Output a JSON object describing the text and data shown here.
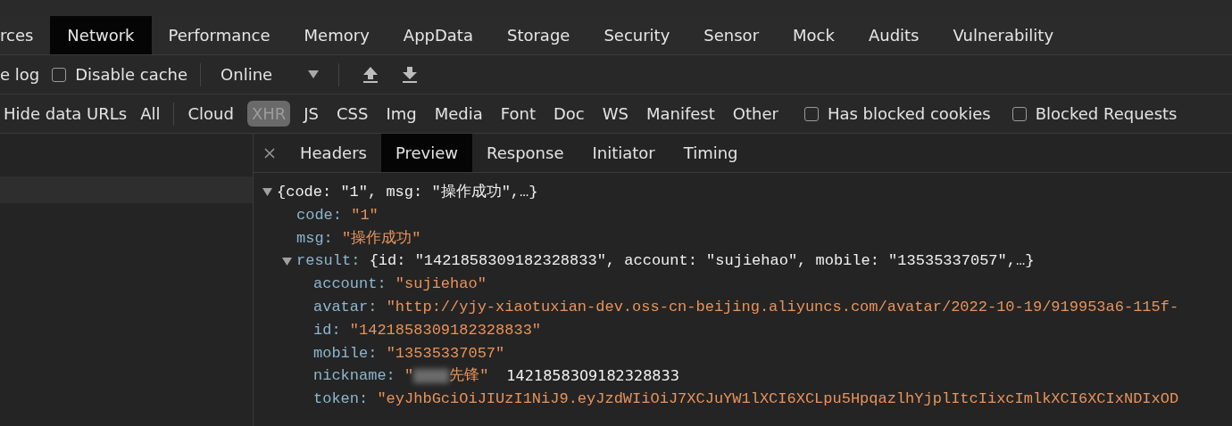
{
  "panel_tabs": [
    {
      "label": "rces",
      "selected": false
    },
    {
      "label": "Network",
      "selected": true
    },
    {
      "label": "Performance",
      "selected": false
    },
    {
      "label": "Memory",
      "selected": false
    },
    {
      "label": "AppData",
      "selected": false
    },
    {
      "label": "Storage",
      "selected": false
    },
    {
      "label": "Security",
      "selected": false
    },
    {
      "label": "Sensor",
      "selected": false
    },
    {
      "label": "Mock",
      "selected": false
    },
    {
      "label": "Audits",
      "selected": false
    },
    {
      "label": "Vulnerability",
      "selected": false
    }
  ],
  "toolbar": {
    "preserve_log_label": "e log",
    "disable_cache": {
      "label": "Disable cache",
      "checked": false
    },
    "throttling": "Online"
  },
  "filter_bar": {
    "hide_data_urls": "Hide data URLs",
    "types": [
      {
        "label": "All",
        "selected": false
      },
      {
        "label": "Cloud",
        "selected": false
      },
      {
        "label": "XHR",
        "selected": true
      },
      {
        "label": "JS",
        "selected": false
      },
      {
        "label": "CSS",
        "selected": false
      },
      {
        "label": "Img",
        "selected": false
      },
      {
        "label": "Media",
        "selected": false
      },
      {
        "label": "Font",
        "selected": false
      },
      {
        "label": "Doc",
        "selected": false
      },
      {
        "label": "WS",
        "selected": false
      },
      {
        "label": "Manifest",
        "selected": false
      },
      {
        "label": "Other",
        "selected": false
      }
    ],
    "options": [
      {
        "label": "Has blocked cookies",
        "checked": false
      },
      {
        "label": "Blocked Requests",
        "checked": false
      }
    ]
  },
  "detail_tabs": [
    {
      "label": "Headers",
      "selected": false
    },
    {
      "label": "Preview",
      "selected": true
    },
    {
      "label": "Response",
      "selected": false
    },
    {
      "label": "Initiator",
      "selected": false
    },
    {
      "label": "Timing",
      "selected": false
    }
  ],
  "preview": {
    "expanded": true,
    "summary": "{code: \"1\", msg: \"操作成功\",…}",
    "children": [
      {
        "kind": "value",
        "key": "code:",
        "value": "\"1\""
      },
      {
        "kind": "value",
        "key": "msg:",
        "value": "\"操作成功\""
      },
      {
        "kind": "object",
        "key": "result:",
        "expanded": true,
        "summary": "{id: \"1421858309182328833\", account: \"sujiehao\", mobile: \"13535337057\",…}",
        "children": [
          {
            "kind": "value",
            "key": "account:",
            "value": "\"sujiehao\""
          },
          {
            "kind": "value",
            "key": "avatar:",
            "value": "\"http://yjy-xiaotuxian-dev.oss-cn-beijing.aliyuncs.com/avatar/2022-10-19/919953a6-115f-"
          },
          {
            "kind": "value",
            "key": "id:",
            "value": "\"1421858309182328833\""
          },
          {
            "kind": "value",
            "key": "mobile:",
            "value": "\"13535337057\""
          },
          {
            "kind": "redacted",
            "key": "nickname:",
            "value_start": "\"",
            "value": "先锋\"",
            "note": "1421858309182328833"
          },
          {
            "kind": "value",
            "key": "token:",
            "value": "\"eyJhbGciOiJIUzI1NiJ9.eyJzdWIiOiJ7XCJuYW1lXCI6XCLpu5HpqazlhYjplItcIixcImlkXCI6XCIxNDIxOD"
          }
        ]
      }
    ]
  }
}
